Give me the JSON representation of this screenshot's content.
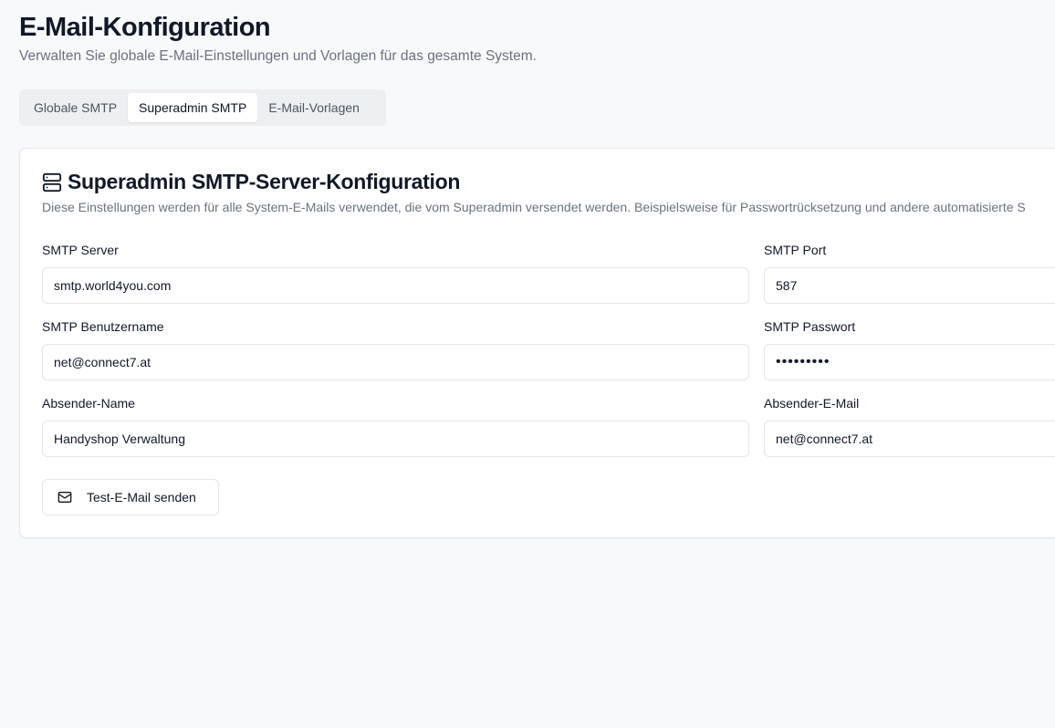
{
  "header": {
    "title": "E-Mail-Konfiguration",
    "subtitle": "Verwalten Sie globale E-Mail-Einstellungen und Vorlagen für das gesamte System."
  },
  "tabs": [
    {
      "label": "Globale SMTP",
      "active": false
    },
    {
      "label": "Superadmin SMTP",
      "active": true
    },
    {
      "label": "E-Mail-Vorlagen",
      "active": false
    }
  ],
  "card": {
    "icon": "server-icon",
    "title": "Superadmin SMTP-Server-Konfiguration",
    "description": "Diese Einstellungen werden für alle System-E-Mails verwendet, die vom Superadmin versendet werden. Beispielsweise für Passwortrücksetzung und andere automatisierte S"
  },
  "form": {
    "smtp_server": {
      "label": "SMTP Server",
      "value": "smtp.world4you.com"
    },
    "smtp_port": {
      "label": "SMTP Port",
      "value": "587"
    },
    "smtp_username": {
      "label": "SMTP Benutzername",
      "value": "net@connect7.at"
    },
    "smtp_password": {
      "label": "SMTP Passwort",
      "value": "•••••••••"
    },
    "sender_name": {
      "label": "Absender-Name",
      "value": "Handyshop Verwaltung"
    },
    "sender_email": {
      "label": "Absender-E-Mail",
      "value": "net@connect7.at"
    }
  },
  "test_button": {
    "icon": "mail-icon",
    "label": "Test-E-Mail senden"
  }
}
